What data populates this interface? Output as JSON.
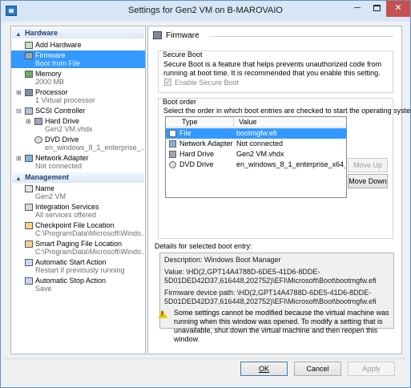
{
  "window": {
    "title": "Settings for Gen2 VM on B-MAROVAIO",
    "controls": {
      "minimize": "─",
      "close": "✕"
    }
  },
  "sidebar": {
    "hardware_header": "Hardware",
    "management_header": "Management",
    "hardware_items": [
      {
        "label": "Add Hardware",
        "sub": "",
        "icon": "add-hardware-icon"
      },
      {
        "label": "Firmware",
        "sub": "Boot from File",
        "icon": "firmware-icon"
      },
      {
        "label": "Memory",
        "sub": "2000 MB",
        "icon": "memory-icon"
      },
      {
        "label": "Processor",
        "sub": "1 Virtual processor",
        "icon": "processor-icon"
      },
      {
        "label": "SCSI Controller",
        "sub": "",
        "icon": "scsi-controller-icon"
      },
      {
        "label": "Hard Drive",
        "sub": "Gen2 VM.vhdx",
        "icon": "hard-drive-icon"
      },
      {
        "label": "DVD Drive",
        "sub": "en_windows_8_1_enterprise_...",
        "icon": "dvd-drive-icon"
      },
      {
        "label": "Network Adapter",
        "sub": "Not connected",
        "icon": "network-adapter-icon"
      }
    ],
    "management_items": [
      {
        "label": "Name",
        "sub": "Gen2 VM",
        "icon": "name-icon"
      },
      {
        "label": "Integration Services",
        "sub": "All services offered",
        "icon": "integration-services-icon"
      },
      {
        "label": "Checkpoint File Location",
        "sub": "C:\\ProgramData\\Microsoft\\Windo...",
        "icon": "checkpoint-icon"
      },
      {
        "label": "Smart Paging File Location",
        "sub": "C:\\ProgramData\\Microsoft\\Windo...",
        "icon": "smart-paging-icon"
      },
      {
        "label": "Automatic Start Action",
        "sub": "Restart if previously running",
        "icon": "auto-start-icon"
      },
      {
        "label": "Automatic Stop Action",
        "sub": "Save",
        "icon": "auto-stop-icon"
      }
    ]
  },
  "panel": {
    "title": "Firmware",
    "secure_boot": {
      "title": "Secure Boot",
      "description": "Secure Boot is a feature that helps prevents unauthorized code from running at boot time. It is recommended that you enable this setting.",
      "checkbox_label": "Enable Secure Boot",
      "checked": true
    },
    "boot_order": {
      "title": "Boot order",
      "description": "Select the order in which boot entries are checked to start the operating system.",
      "columns": [
        "Type",
        "Value"
      ],
      "rows": [
        {
          "type": "File",
          "value": "bootmgfw.efi",
          "selected": true
        },
        {
          "type": "Network Adapter",
          "value": "Not connected"
        },
        {
          "type": "Hard Drive",
          "value": "Gen2 VM.vhdx"
        },
        {
          "type": "DVD Drive",
          "value": "en_windows_8_1_enterprise_x64_d..."
        }
      ],
      "move_up": "Move Up",
      "move_down": "Move Down"
    },
    "details": {
      "title": "Details for selected boot entry:",
      "description": "Description: Windows Boot Manager",
      "value": "Value: \\HD(2,GPT14A4788D-6DE5-41D6-8DDE-5D01DED42D37,616448,202752)\\EFI\\Microsoft\\Boot\\bootmgfw.efi",
      "firmware_path": "Firmware device path: \\HD(2,GPT14A4788D-6DE5-41D6-8DDE-5D01DED42D37,616448,202752)\\EFI\\Microsoft\\Boot\\bootmgfw.efi"
    },
    "warning": "Some settings cannot be modified because the virtual machine was running when this window was opened. To modify a setting that is unavailable, shut down the virtual machine and then reopen this window."
  },
  "footer": {
    "ok": "OK",
    "cancel": "Cancel",
    "apply": "Apply"
  }
}
